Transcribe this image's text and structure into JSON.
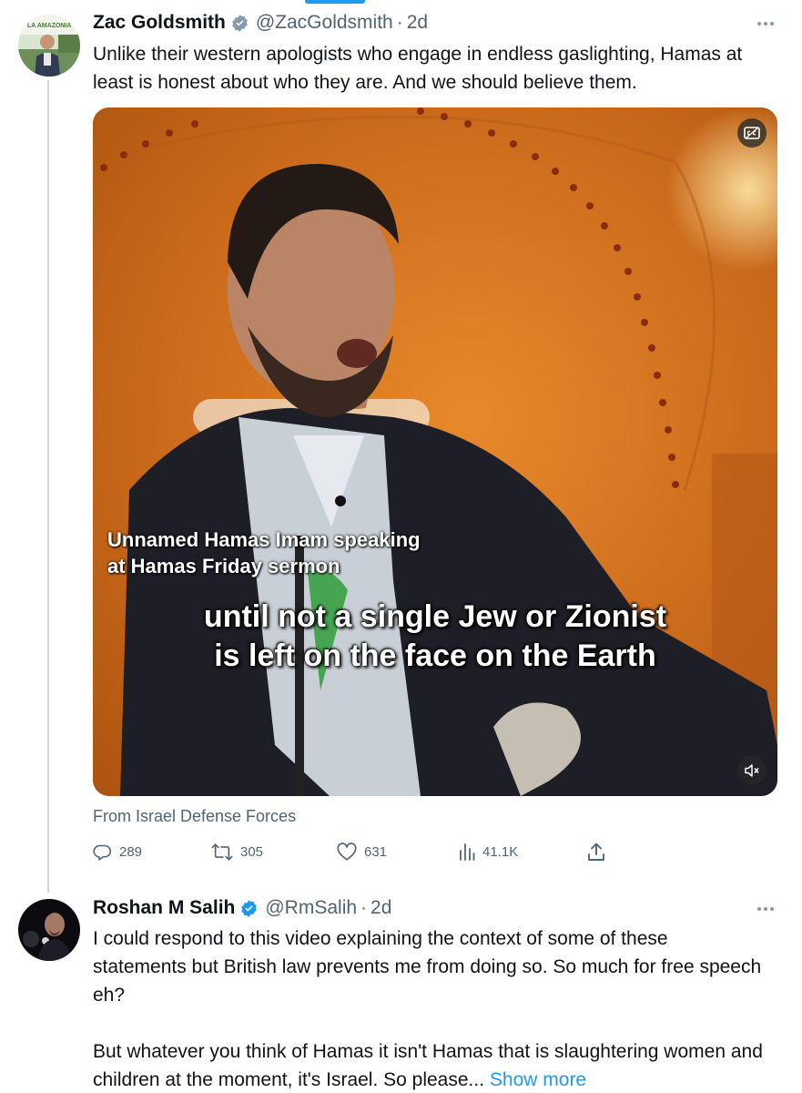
{
  "tweets": [
    {
      "author_name": "Zac Goldsmith",
      "handle": "@ZacGoldsmith",
      "separator": "·",
      "time": "2d",
      "avatar_text": "LA AMAZONIA",
      "text": "Unlike their western apologists who engage in endless gaslighting, Hamas at least is honest about who they are. And we should believe them.",
      "media": {
        "caption_small_line1": "Unnamed Hamas Imam speaking",
        "caption_small_line2": "at Hamas Friday sermon",
        "caption_big_line1": "until not a single Jew or Zionist",
        "caption_big_line2": "is left on the face on the Earth"
      },
      "source": "From Israel Defense Forces",
      "actions": {
        "replies": "289",
        "retweets": "305",
        "likes": "631",
        "views": "41.1K"
      }
    },
    {
      "author_name": "Roshan M Salih",
      "handle": "@RmSalih",
      "separator": "·",
      "time": "2d",
      "paragraph1": "I could respond to this video explaining the context of some of these statements but British law prevents me from doing so. So much for free speech eh?",
      "paragraph2": "But whatever you think of Hamas it isn't Hamas that is slaughtering women and children at the moment, it's Israel. So please...",
      "show_more": "Show more"
    }
  ],
  "icons": {
    "verified": "verified-badge-icon",
    "more": "more-options-icon",
    "reply": "reply-icon",
    "retweet": "retweet-icon",
    "like": "like-icon",
    "views": "views-icon",
    "share": "share-icon",
    "captions": "captions-icon",
    "mute": "mute-icon"
  },
  "colors": {
    "accent": "#1d9bf0",
    "text_primary": "#0f1419",
    "text_secondary": "#536471",
    "thread_line": "#cfd9de"
  }
}
